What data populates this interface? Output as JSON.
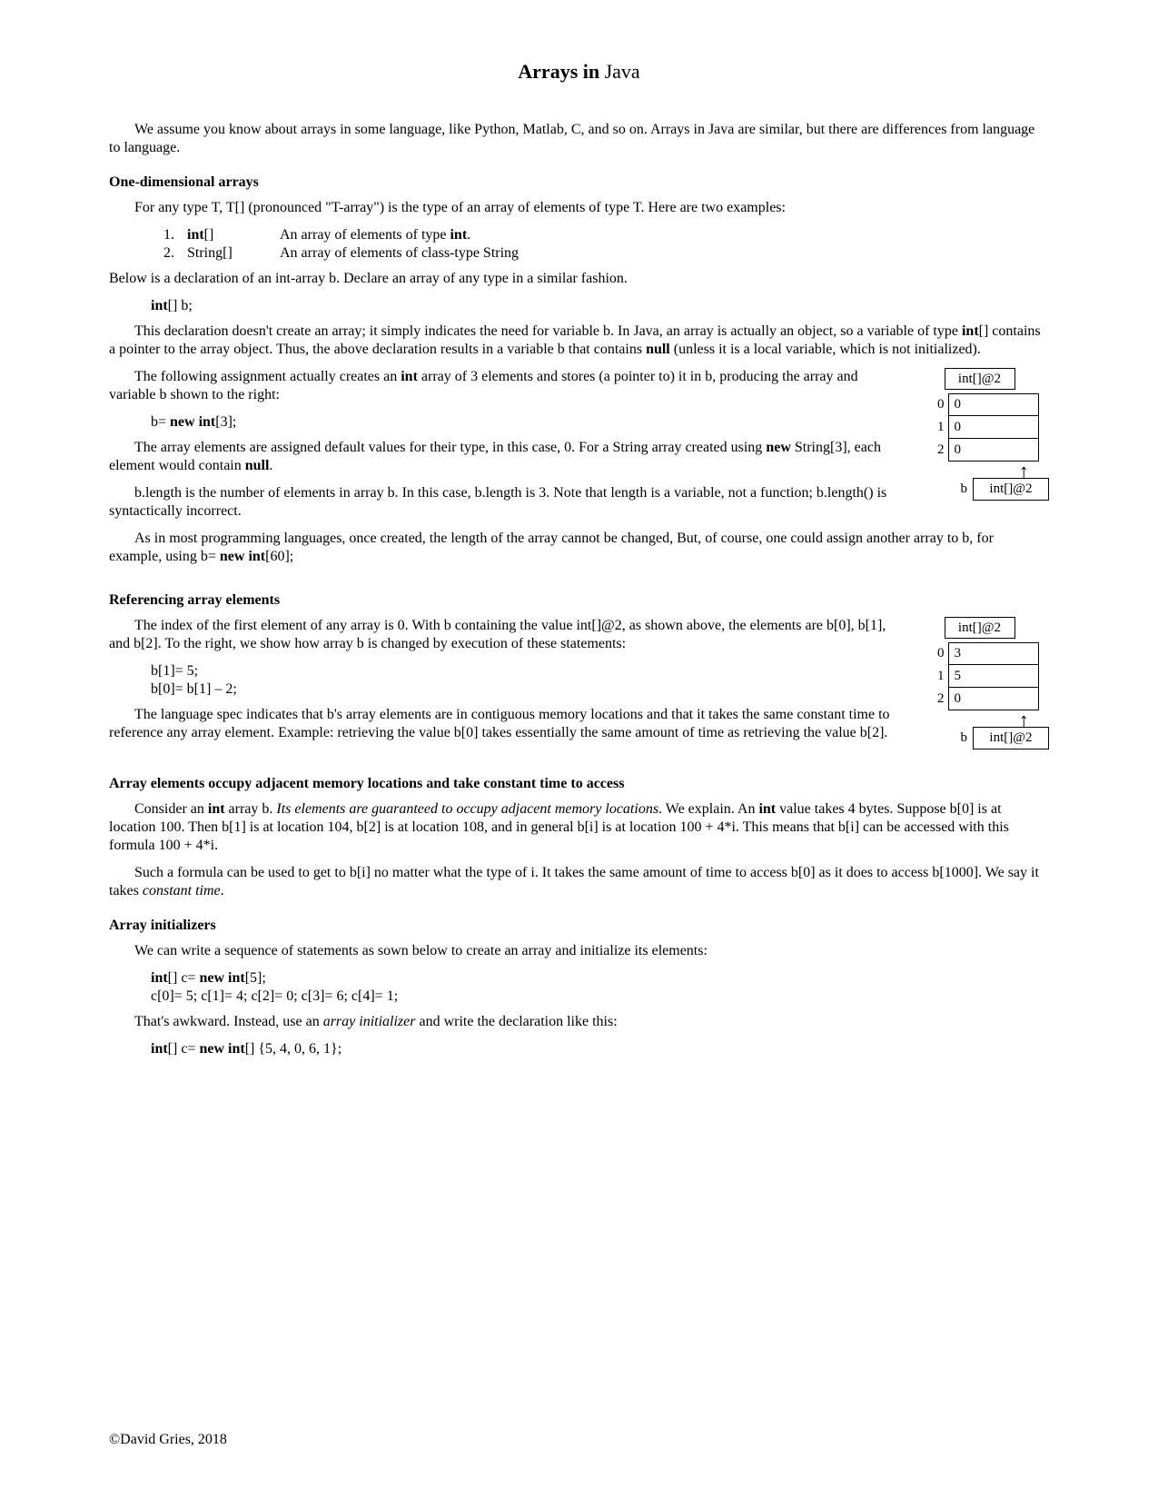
{
  "title_part1": "Arrays in",
  "title_part2": " Java",
  "para1": "We assume you know about arrays in some language, like Python, Matlab, C, and so on. Arrays in Java are similar, but there are differences from language to language.",
  "sec1": "One-dimensional arrays",
  "para2": "For any type T, T[] (pronounced \"T-array\") is the type of an array of elements of type T. Here are two examples:",
  "list1": {
    "n1": "1.",
    "t1a": "int",
    "t1b": "[]",
    "d1a": "An array of elements of type ",
    "d1b": "int",
    "d1c": ".",
    "n2": "2.",
    "t2": "String[]",
    "d2": "An array of elements of class-type String"
  },
  "para3": "Below is a declaration of an int-array b. Declare an array of any type in a similar fashion.",
  "code1a": "int",
  "code1b": "[] b;",
  "para4a": "This declaration doesn't create an array; it simply indicates the need for variable b. In Java, an array is actually an object, so a variable of type ",
  "para4b": "int",
  "para4c": "[] contains a pointer to the array object. Thus, the above declaration results in a variable b that contains ",
  "para4d": "null",
  "para4e": " (unless it is a local variable, which is not initialized).",
  "para5a": "The following assignment actually creates an ",
  "para5b": "int",
  "para5c": " array of 3 elements and stores (a pointer to) it in b, producing the array and variable b shown to the right:",
  "code2a": "b= ",
  "code2b": "new int",
  "code2c": "[3];",
  "para6a": "The array elements are assigned default values for their type, in this case, 0. For a String array created using ",
  "para6b": "new",
  "para6c": " String[3], each element would contain ",
  "para6d": "null",
  "para6e": ".",
  "para7": "b.length is the number of elements in array b. In this case, b.length is 3. Note that length is a variable, not a function; b.length() is syntactically incorrect.",
  "para8a": "As in most programming languages, once created, the length of the array cannot be changed, But, of course, one could assign another array to b, for example, using b= ",
  "para8b": "new int",
  "para8c": "[60];",
  "sec2": "Referencing array elements",
  "para9": "The index of the first element of any array is 0. With b containing the value int[]@2, as shown above, the elements are b[0], b[1], and b[2]. To the right, we show how array b is changed by execution of these statements:",
  "code3a": "b[1]= 5;",
  "code3b": "b[0]= b[1] – 2;",
  "para10": "The language spec indicates that b's array elements are in contiguous memory locations and that it takes the same constant time to reference any array element. Example: retrieving the value b[0] takes essentially the same amount of time as retrieving the value b[2].",
  "sec3": "Array elements occupy adjacent memory locations and take constant time to access",
  "para11a": "Consider an ",
  "para11b": "int",
  "para11c": " array b. ",
  "para11d": "Its elements are guaranteed to occupy adjacent memory locations",
  "para11e": ". We explain. An ",
  "para11f": "int",
  "para11g": " value takes 4 bytes. Suppose b[0] is at location 100. Then b[1] is at location 104, b[2] is at location 108, and in general b[i] is at location 100 + 4*i. This means that b[i] can be accessed with this formula 100 + 4*i.",
  "para12a": "Such a formula can be used to get to b[i] no matter what the type of i. It takes the same amount of time to access b[0] as it does to access b[1000]. We say it takes ",
  "para12b": "constant time",
  "para12c": ".",
  "sec4": "Array initializers",
  "para13": "We can write a sequence of statements as sown below to create an array and initialize its elements:",
  "code4a": "int",
  "code4b": "[] c= ",
  "code4c": "new int",
  "code4d": "[5];",
  "code4e": "c[0]= 5; c[1]= 4; c[2]= 0; c[3]= 6; c[4]= 1;",
  "para14a": "That's awkward. Instead, use an ",
  "para14b": "array initializer",
  "para14c": " and write the declaration like this:",
  "code5a": "int",
  "code5b": "[] c= ",
  "code5c": "new int",
  "code5d": "[] {5, 4, 0, 6, 1};",
  "footer": "©David Gries, 2018",
  "diagram1": {
    "tag": "int[]@2",
    "rows": [
      {
        "idx": "0",
        "val": "0"
      },
      {
        "idx": "1",
        "val": "0"
      },
      {
        "idx": "2",
        "val": "0"
      }
    ],
    "arrow": "↑",
    "ptr_label": "b",
    "ptr_val": "int[]@2"
  },
  "diagram2": {
    "tag": "int[]@2",
    "rows": [
      {
        "idx": "0",
        "val": "3"
      },
      {
        "idx": "1",
        "val": "5"
      },
      {
        "idx": "2",
        "val": "0"
      }
    ],
    "arrow": "↑",
    "ptr_label": "b",
    "ptr_val": "int[]@2"
  }
}
